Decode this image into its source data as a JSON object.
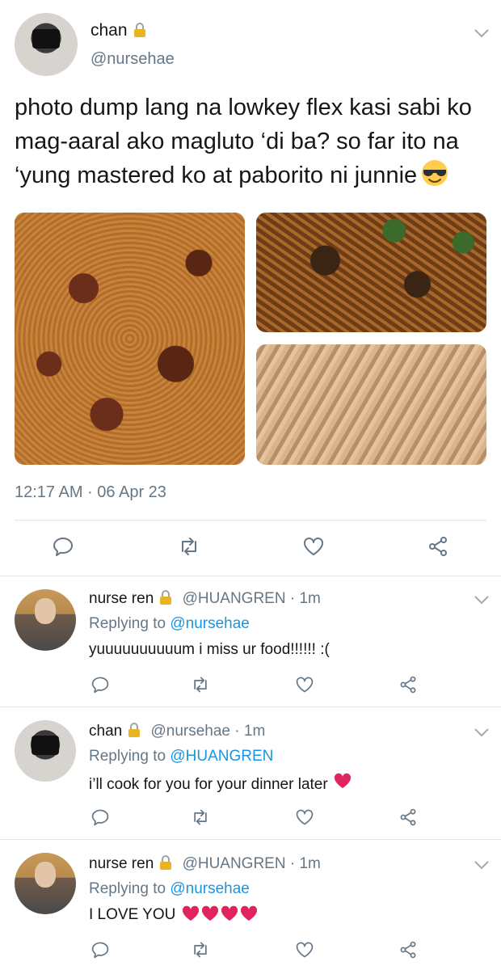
{
  "main_tweet": {
    "name": "chan",
    "handle": "@nursehae",
    "text": "photo dump lang na lowkey flex kasi sabi ko mag-aaral ako magluto ‘di ba? so far ito na ‘yung mastered ko at paborito ni junnie",
    "emoji": "sunglasses-emoji",
    "timestamp": "12:17 AM · 06 Apr 23"
  },
  "replies": [
    {
      "name": "nurse ren",
      "handle": "@HUANGREN · 1m",
      "replying_label": "Replying to",
      "replying_to": "@nursehae",
      "text": "yuuuuuuuuuum i miss ur food!!!!!! :("
    },
    {
      "name": "chan",
      "handle": "@nursehae · 1m",
      "replying_label": "Replying to",
      "replying_to": "@HUANGREN",
      "text": "i’ll cook for you for your dinner later"
    },
    {
      "name": "nurse ren",
      "handle": "@HUANGREN · 1m",
      "replying_label": "Replying to",
      "replying_to": "@nursehae",
      "text": "I LOVE YOU"
    }
  ],
  "colors": {
    "text": "#14171a",
    "secondary": "#657786",
    "link": "#1b95e0",
    "divider": "#e1e8ed",
    "heart_emoji": "#e0245e"
  },
  "icons": [
    "lock-icon",
    "chevron-down-icon",
    "reply-icon",
    "retweet-icon",
    "like-icon",
    "share-icon",
    "heart-emoji"
  ]
}
